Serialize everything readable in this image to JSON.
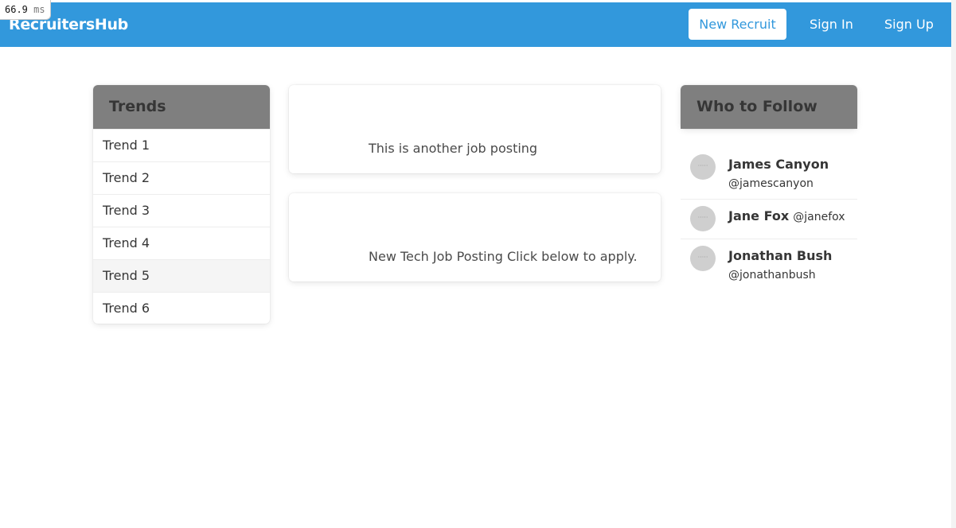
{
  "timing": {
    "value": "66.9",
    "unit": "ms"
  },
  "navbar": {
    "brand": "RecruitersHub",
    "new_recruit": "New Recruit",
    "sign_in": "Sign In",
    "sign_up": "Sign Up",
    "background": "#3298dc"
  },
  "trends": {
    "title": "Trends",
    "items": [
      "Trend 1",
      "Trend 2",
      "Trend 3",
      "Trend 4",
      "Trend 5",
      "Trend 6"
    ]
  },
  "posts": [
    {
      "text": "This is another job posting"
    },
    {
      "text": "New Tech Job Posting Click below to apply."
    }
  ],
  "follow": {
    "title": "Who to Follow",
    "people": [
      {
        "name": "James Canyon",
        "handle": "@jamescanyon"
      },
      {
        "name": "Jane Fox",
        "handle": "@janefox"
      },
      {
        "name": "Jonathan Bush",
        "handle": "@jonathanbush"
      }
    ]
  }
}
